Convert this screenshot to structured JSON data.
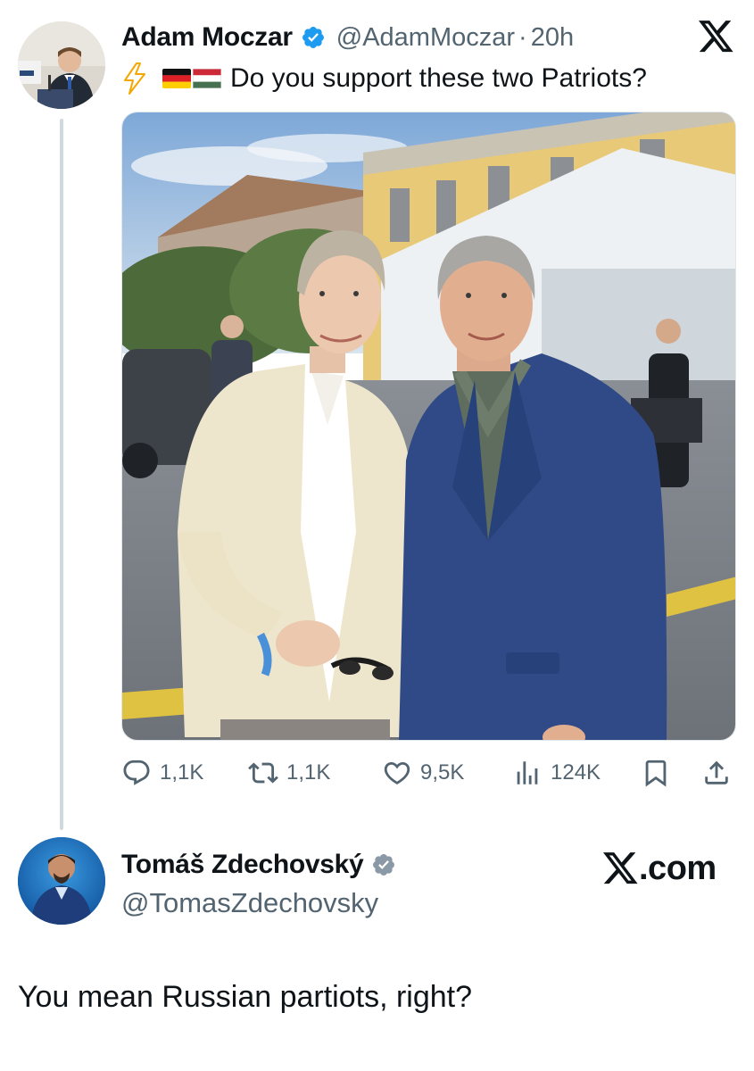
{
  "original_tweet": {
    "author": {
      "display_name": "Adam Moczar",
      "verified": true,
      "handle": "@AdamMoczar",
      "separator": "·",
      "time": "20h"
    },
    "text": "Do you support these two Patriots?",
    "emoji": [
      "high-voltage",
      "flag-germany",
      "flag-hungary"
    ],
    "photo": {
      "subject": "two people posing together outdoors in front of a yellow building and a white tent"
    },
    "actions": {
      "replies": "1,1K",
      "reposts": "1,1K",
      "likes": "9,5K",
      "views": "124K"
    }
  },
  "reply": {
    "author": {
      "display_name": "Tomáš Zdechovský",
      "verified": true,
      "handle": "@TomasZdechovsky"
    },
    "text": "You mean Russian partiots, right?"
  },
  "brand_label": ".com",
  "colors": {
    "text": "#0f1419",
    "secondary": "#536471",
    "verified": "#1d9bf0",
    "thread_line": "#cfd9de"
  }
}
